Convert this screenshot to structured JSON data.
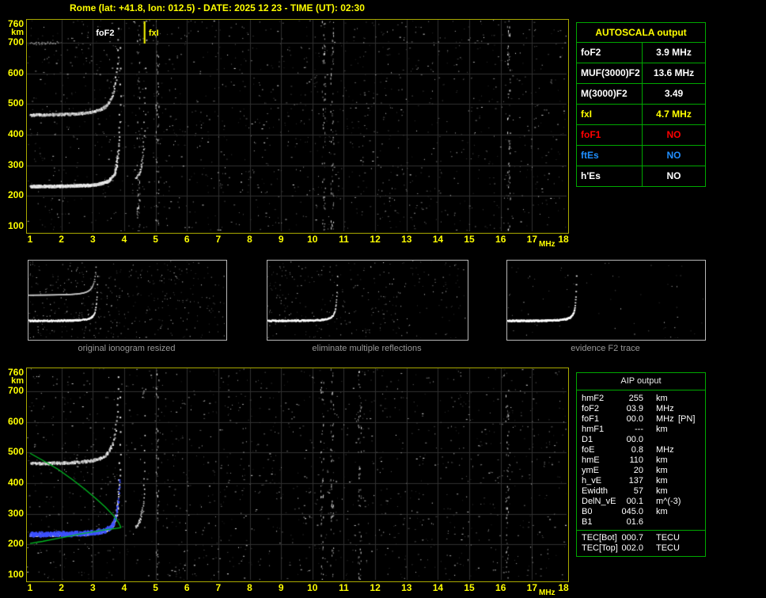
{
  "title": "Rome (lat: +41.8, lon: 012.5) - DATE: 2025 12 23 - TIME (UT): 02:30",
  "autoscala_table": {
    "title": "AUTOSCALA output",
    "rows": [
      {
        "label": "foF2",
        "value": "3.9 MHz",
        "color": "#ffffff"
      },
      {
        "label": "MUF(3000)F2",
        "value": "13.6 MHz",
        "color": "#ffffff"
      },
      {
        "label": "M(3000)F2",
        "value": "3.49",
        "color": "#ffffff"
      },
      {
        "label": "fxI",
        "value": "4.7 MHz",
        "color": "#ffff00"
      },
      {
        "label": "foF1",
        "value": "NO",
        "color": "#ff0000"
      },
      {
        "label": "ftEs",
        "value": "NO",
        "color": "#1f8fff"
      },
      {
        "label": "h'Es",
        "value": "NO",
        "color": "#ffffff"
      }
    ]
  },
  "aip_table": {
    "title": "AIP output",
    "rows": [
      {
        "label": "hmF2",
        "value": "255",
        "unit": "km",
        "note": ""
      },
      {
        "label": "foF2",
        "value": "03.9",
        "unit": "MHz",
        "note": ""
      },
      {
        "label": "foF1",
        "value": "00.0",
        "unit": "MHz",
        "note": "[PN]"
      },
      {
        "label": "hmF1",
        "value": "---",
        "unit": "km",
        "note": ""
      },
      {
        "label": "D1",
        "value": "00.0",
        "unit": "",
        "note": ""
      },
      {
        "label": "foE",
        "value": "0.8",
        "unit": "MHz",
        "note": ""
      },
      {
        "label": "hmE",
        "value": "110",
        "unit": "km",
        "note": ""
      },
      {
        "label": "ymE",
        "value": "20",
        "unit": "km",
        "note": ""
      },
      {
        "label": "h_vE",
        "value": "137",
        "unit": "km",
        "note": ""
      },
      {
        "label": "Ewidth",
        "value": "57",
        "unit": "km",
        "note": ""
      },
      {
        "label": "DelN_vE",
        "value": "00.1",
        "unit": "m^(-3)",
        "note": ""
      },
      {
        "label": "B0",
        "value": "045.0",
        "unit": "km",
        "note": ""
      },
      {
        "label": "B1",
        "value": "01.6",
        "unit": "",
        "note": ""
      }
    ],
    "tec_rows": [
      {
        "label": "TEC[Bot]",
        "value": "000.7",
        "unit": "TECU"
      },
      {
        "label": "TEC[Top]",
        "value": "002.0",
        "unit": "TECU"
      }
    ]
  },
  "thumbnails": [
    {
      "caption": "original ionogram resized"
    },
    {
      "caption": "eliminate multiple reflections"
    },
    {
      "caption": "evidence F2 trace"
    }
  ],
  "chart_data": [
    {
      "type": "scatter",
      "name": "recorded-ionogram",
      "xlabel": "MHz",
      "ylabel": "km",
      "xlim": [
        1,
        18
      ],
      "ylim": [
        100,
        760
      ],
      "grid": true,
      "x_ticks": [
        1,
        2,
        3,
        4,
        5,
        6,
        7,
        8,
        9,
        10,
        11,
        12,
        13,
        14,
        15,
        16,
        17,
        18
      ],
      "y_ticks": [
        760,
        700,
        600,
        500,
        400,
        300,
        200,
        100
      ],
      "annotations": [
        {
          "text": "foF2",
          "x_MHz": 3.1,
          "color": "#ffffff"
        },
        {
          "text": "fxI",
          "x_MHz": 4.78,
          "color": "#ffff00"
        }
      ],
      "scaled_values": {
        "foF2_MHz": 3.9,
        "fxI_MHz": 4.7,
        "MUF3000F2_MHz": 13.6,
        "M3000F2": 3.49
      },
      "trace": {
        "description": "F2-layer echo trace",
        "first_hop_virtual_height_km_at_1MHz": 235,
        "second_hop_virtual_height_km_at_1MHz": 470,
        "critical_frequency_MHz": 3.9
      }
    },
    {
      "type": "scatter",
      "name": "ionogram-with-aip-profile",
      "xlabel": "MHz",
      "ylabel": "km",
      "xlim": [
        1,
        18
      ],
      "ylim": [
        100,
        760
      ],
      "grid": true,
      "x_ticks": [
        1,
        2,
        3,
        4,
        5,
        6,
        7,
        8,
        9,
        10,
        11,
        12,
        13,
        14,
        15,
        16,
        17,
        18
      ],
      "y_ticks": [
        760,
        700,
        600,
        500,
        400,
        300,
        200,
        100
      ],
      "annotations": [],
      "restored_trace_color": "#3c50ff",
      "profile": {
        "color": "#00bb22",
        "foF2_MHz": 3.9,
        "hmF2_km": 255,
        "bottomside_points": [
          [
            1.0,
            203
          ],
          [
            1.4,
            210
          ],
          [
            1.8,
            218
          ],
          [
            2.2,
            226
          ],
          [
            2.6,
            234
          ],
          [
            3.0,
            241
          ],
          [
            3.4,
            248
          ],
          [
            3.7,
            252
          ],
          [
            3.9,
            255
          ]
        ],
        "topside_points": [
          [
            3.9,
            255
          ],
          [
            3.82,
            272
          ],
          [
            3.65,
            295
          ],
          [
            3.4,
            322
          ],
          [
            3.1,
            350
          ],
          [
            2.75,
            380
          ],
          [
            2.35,
            412
          ],
          [
            1.9,
            445
          ],
          [
            1.45,
            472
          ],
          [
            1.0,
            498
          ]
        ]
      }
    }
  ]
}
